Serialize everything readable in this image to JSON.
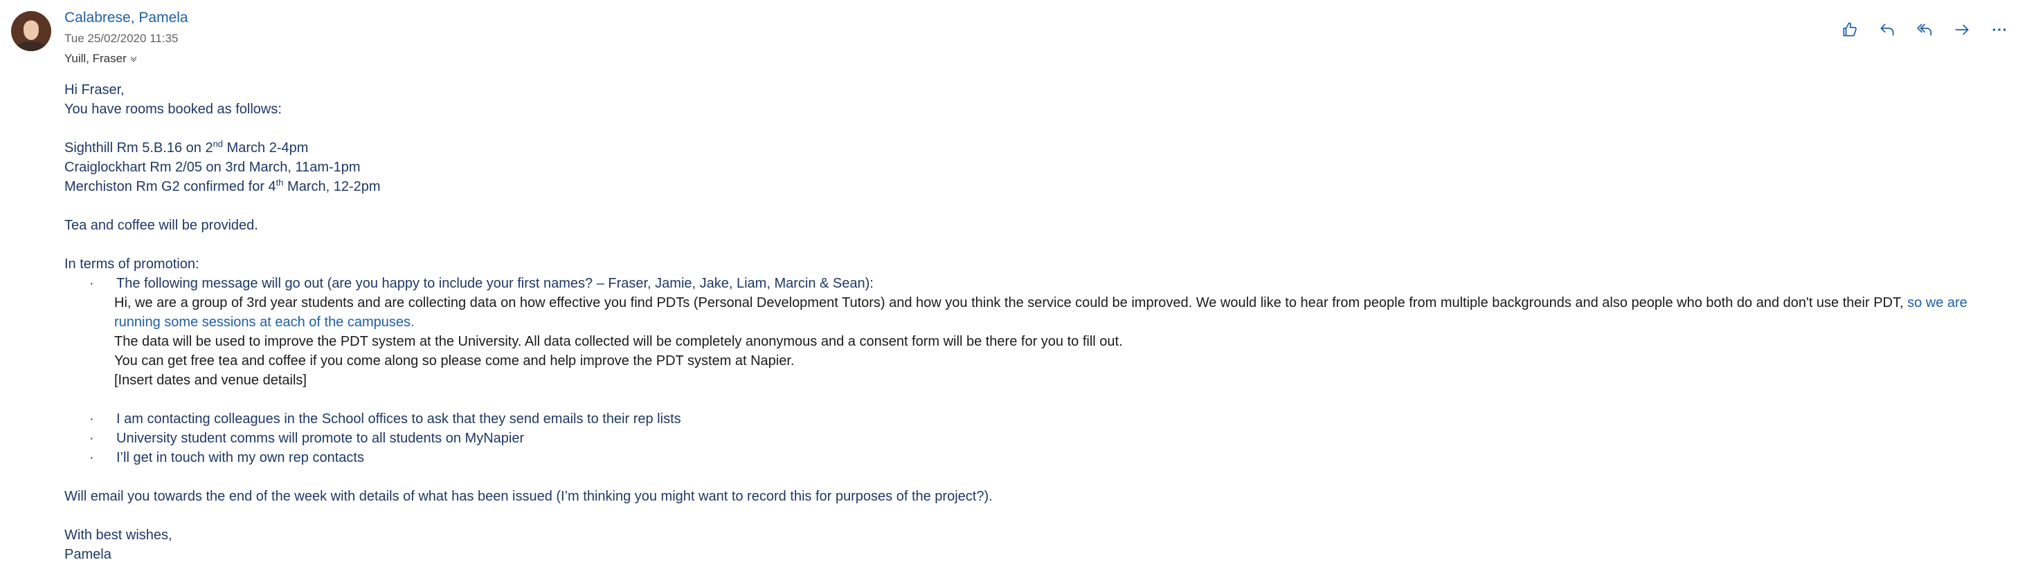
{
  "sender": {
    "name": "Calabrese, Pamela",
    "datetime": "Tue 25/02/2020 11:35",
    "to": "Yuill, Fraser"
  },
  "toolbar": {
    "icons": [
      "like-icon",
      "reply-icon",
      "reply-all-icon",
      "forward-icon",
      "more-icon"
    ],
    "accent": "#1f5ea8"
  },
  "message": {
    "greeting": "Hi Fraser,",
    "intro": "You have rooms booked as follows:",
    "booking1_a": "Sighthill Rm 5.B.16 on 2",
    "booking1_sup": "nd",
    "booking1_b": " March 2-4pm",
    "booking2": "Craiglockhart Rm 2/05 on 3rd March, 11am-1pm",
    "booking3_a": "Merchiston Rm G2 confirmed for 4",
    "booking3_sup": "th",
    "booking3_b": " March, 12-2pm",
    "refreshments": "Tea and coffee will be provided.",
    "promotion_heading": "In terms of promotion:",
    "bullet_char": "·",
    "bullet1": "The following message will go out (are you happy to include your first names? – Fraser, Jamie, Jake, Liam, Marcin & Sean):",
    "quote_line1a": "Hi, we are a group of 3rd year students and are collecting data on how effective you find PDTs (Personal Development Tutors) and how you think the service could be improved. We would like to hear from people from multiple backgrounds and also people who both do and don't use their PDT, ",
    "quote_line1b": "so we are running some sessions at each of the campuses.",
    "quote_line2": "The data will be used to improve the PDT system at the University. All data collected will be completely anonymous and a consent form will be there for you to fill out.",
    "quote_line3": "You can get free tea and coffee if you come along so please come and help improve the PDT system at Napier.",
    "quote_line4": "[Insert dates and venue details]",
    "bullet2": "I am contacting colleagues in the School offices to ask that they send emails to their rep lists",
    "bullet3": "University student comms will promote to all students on MyNapier",
    "bullet4": "I’ll get in touch with my own rep contacts",
    "closing": "Will email you towards the end of the week with details of what has been issued (I’m thinking you might want to record this for purposes of the project?).",
    "signoff": "With best wishes,",
    "signature": "Pamela"
  }
}
